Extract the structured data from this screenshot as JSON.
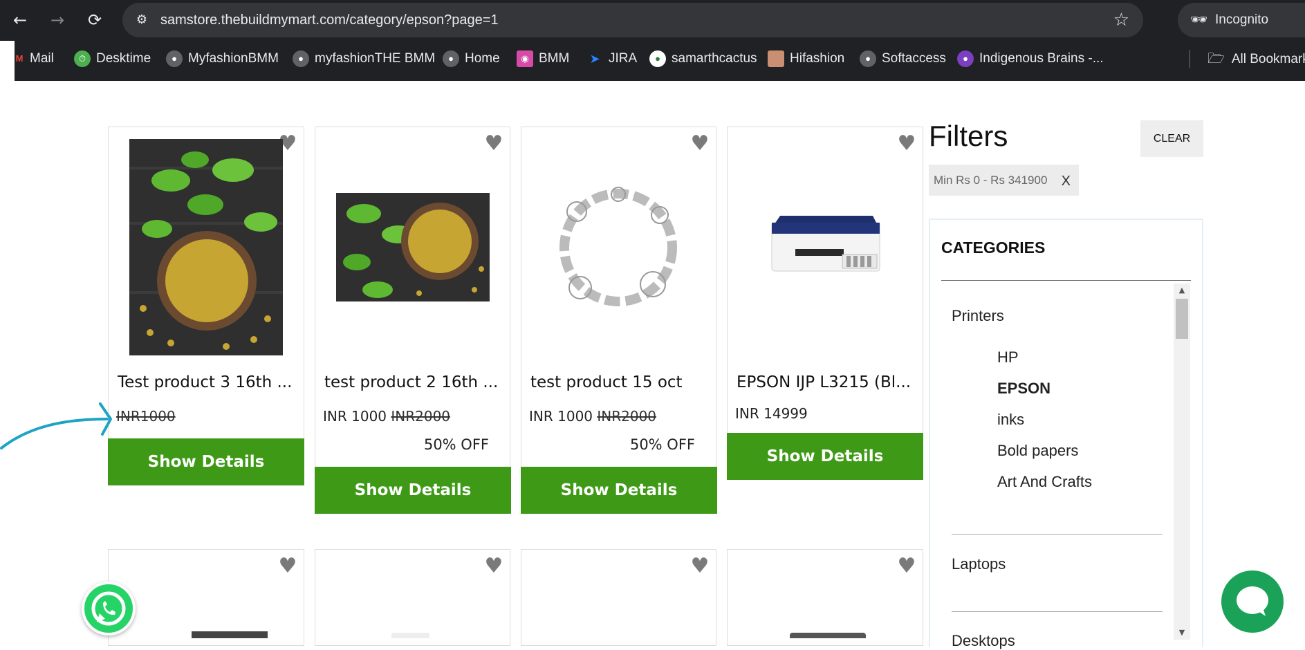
{
  "browser": {
    "url": "samstore.thebuildmymart.com/category/epson?page=1",
    "incognito_label": "Incognito",
    "bookmarks": [
      {
        "label": "Mail",
        "icon": "gmail-icon"
      },
      {
        "label": "Desktime",
        "icon": "desktime-icon"
      },
      {
        "label": "MyfashionBMM",
        "icon": "globe-icon"
      },
      {
        "label": "myfashionTHE BMM",
        "icon": "globe-icon"
      },
      {
        "label": "Home",
        "icon": "globe-icon"
      },
      {
        "label": "BMM",
        "icon": "bmm-icon"
      },
      {
        "label": "JIRA",
        "icon": "jira-icon"
      },
      {
        "label": "samarthcactus",
        "icon": "cactus-icon"
      },
      {
        "label": "Hifashion",
        "icon": "hifashion-icon"
      },
      {
        "label": "Softaccess",
        "icon": "globe-icon"
      },
      {
        "label": "Indigenous Brains -...",
        "icon": "indigenous-icon"
      }
    ],
    "all_bookmarks_label": "All Bookmarks"
  },
  "products": [
    {
      "name": "Test product 3 16th ...",
      "price": "",
      "mrp": "INR1000",
      "discount": "",
      "button": "Show Details"
    },
    {
      "name": "test product 2 16th ...",
      "price": "INR 1000",
      "mrp": "INR2000",
      "discount": "50% OFF",
      "button": "Show Details"
    },
    {
      "name": "test product 15 oct",
      "price": "INR 1000",
      "mrp": "INR2000",
      "discount": "50% OFF",
      "button": "Show Details"
    },
    {
      "name": "EPSON IJP L3215 (Bl...",
      "price": "INR 14999",
      "mrp": "",
      "discount": "",
      "button": "Show Details"
    }
  ],
  "filters": {
    "title": "Filters",
    "clear_label": "CLEAR",
    "price_chip": "Min Rs 0 - Rs 341900",
    "chip_close": "X",
    "categories_title": "CATEGORIES",
    "categories": [
      {
        "name": "Printers",
        "children": [
          "HP",
          "EPSON",
          "inks",
          "Bold papers",
          "Art And Crafts"
        ]
      },
      {
        "name": "Laptops",
        "children": []
      },
      {
        "name": "Desktops",
        "children": []
      }
    ],
    "selected_child": "EPSON"
  },
  "colors": {
    "button_green": "#3e9a16",
    "chat_green": "#1aa258",
    "whatsapp_green": "#25d366",
    "annotation_arrow": "#1ea3c5"
  }
}
